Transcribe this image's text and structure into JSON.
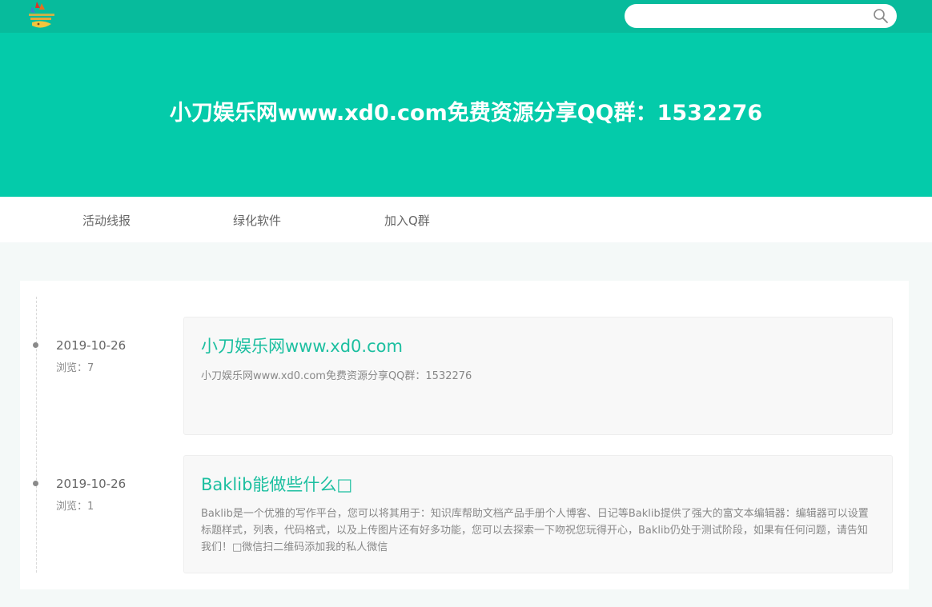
{
  "header": {
    "logo_icon": "site-logo",
    "search": {
      "value": "",
      "placeholder": "",
      "icon": "search-icon"
    }
  },
  "hero": {
    "title": "小刀娱乐网www.xd0.com免费资源分享QQ群：1532276",
    "background": "#04cbaa"
  },
  "nav": {
    "items": [
      {
        "label": "活动线报"
      },
      {
        "label": "绿化软件"
      },
      {
        "label": "加入Q群"
      }
    ]
  },
  "posts": [
    {
      "date": "2019-10-26",
      "views": "浏览：7",
      "title": "小刀娱乐网www.xd0.com",
      "desc": "小刀娱乐网www.xd0.com免费资源分享QQ群：1532276"
    },
    {
      "date": "2019-10-26",
      "views": "浏览：1",
      "title": "Baklib能做些什么□",
      "desc": "Baklib是一个优雅的写作平台，您可以将其用于：知识库帮助文档产品手册个人博客、日记等Baklib提供了强大的富文本编辑器：编辑器可以设置标题样式，列表，代码格式，以及上传图片还有好多功能，您可以去探索一下吻祝您玩得开心，Baklib仍处于测试阶段，如果有任何问题，请告知我们！□微信扫二维码添加我的私人微信"
    }
  ],
  "colors": {
    "topbar": "#07bb9c",
    "accent": "#1cbfa0"
  }
}
